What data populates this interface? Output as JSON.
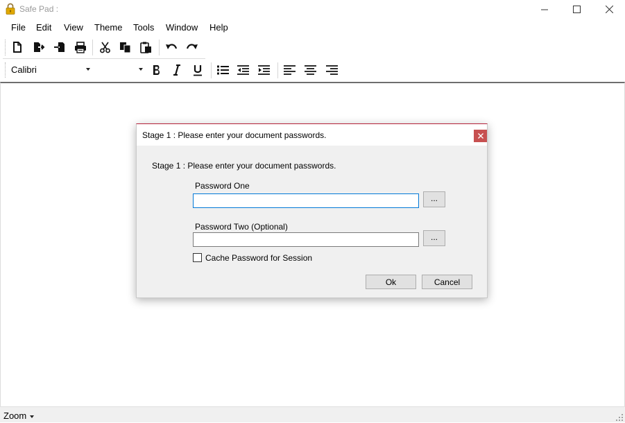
{
  "window": {
    "title": "Safe Pad :",
    "controls": [
      "minimize-icon",
      "maximize-icon",
      "close-icon"
    ]
  },
  "menu": {
    "items": [
      "File",
      "Edit",
      "View",
      "Theme",
      "Tools",
      "Window",
      "Help"
    ]
  },
  "toolbar": {
    "buttons": [
      "new-document-icon",
      "open-icon",
      "save-icon",
      "print-icon",
      "cut-icon",
      "copy-icon",
      "paste-icon",
      "undo-icon",
      "redo-icon"
    ]
  },
  "format_bar": {
    "font_name": "Calibri",
    "font_size": "",
    "buttons": [
      "bold-icon",
      "italic-icon",
      "underline-icon",
      "bullet-list-icon",
      "outdent-icon",
      "indent-icon",
      "align-left-icon",
      "align-center-icon",
      "align-right-icon"
    ]
  },
  "status_bar": {
    "zoom_label": "Zoom"
  },
  "dialog": {
    "title": "Stage 1 : Please enter your document passwords.",
    "heading": "Stage 1 : Please enter your document passwords.",
    "password_one_label": "Password One",
    "password_one_value": "",
    "password_two_label": "Password Two (Optional)",
    "password_two_value": "",
    "browse_label": "...",
    "cache_label": "Cache Password for Session",
    "cache_checked": false,
    "ok_label": "Ok",
    "cancel_label": "Cancel"
  },
  "colors": {
    "dialog_accent": "#b5213a",
    "close_button": "#c75050",
    "focus_border": "#0078d7",
    "padlock": "#e0a800"
  }
}
